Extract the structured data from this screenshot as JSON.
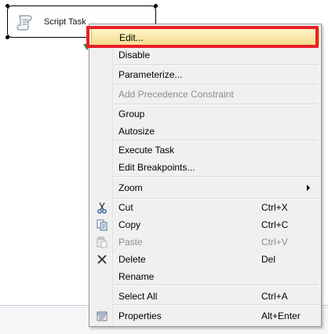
{
  "task": {
    "label": "Script Task"
  },
  "menu": {
    "items": [
      {
        "label": "Edit...",
        "shortcut": "",
        "icon": "",
        "highlighted": true
      },
      {
        "label": "Disable",
        "shortcut": "",
        "icon": ""
      },
      {
        "label": "Parameterize...",
        "shortcut": "",
        "icon": ""
      },
      {
        "label": "Add Precedence Constraint",
        "shortcut": "",
        "icon": "",
        "disabled": true
      },
      {
        "label": "Group",
        "shortcut": "",
        "icon": ""
      },
      {
        "label": "Autosize",
        "shortcut": "",
        "icon": ""
      },
      {
        "label": "Execute Task",
        "shortcut": "",
        "icon": ""
      },
      {
        "label": "Edit Breakpoints...",
        "shortcut": "",
        "icon": ""
      },
      {
        "label": "Zoom",
        "shortcut": "",
        "icon": "",
        "submenu": true
      },
      {
        "label": "Cut",
        "shortcut": "Ctrl+X",
        "icon": "scissors-icon"
      },
      {
        "label": "Copy",
        "shortcut": "Ctrl+C",
        "icon": "copy-icon"
      },
      {
        "label": "Paste",
        "shortcut": "Ctrl+V",
        "icon": "paste-icon",
        "disabled": true
      },
      {
        "label": "Delete",
        "shortcut": "Del",
        "icon": "delete-x-icon"
      },
      {
        "label": "Rename",
        "shortcut": "",
        "icon": ""
      },
      {
        "label": "Select All",
        "shortcut": "Ctrl+A",
        "icon": ""
      },
      {
        "label": "Properties",
        "shortcut": "Alt+Enter",
        "icon": "properties-icon"
      }
    ]
  },
  "colors": {
    "highlight_box": "#e8202a",
    "hover_item": "#f6dd8b",
    "connector": "#2d8c3a"
  }
}
